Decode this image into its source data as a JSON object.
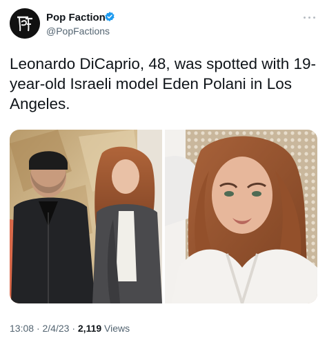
{
  "author": {
    "name": "Pop Faction",
    "handle": "@PopFactions",
    "avatar_icon": "pf-monogram-logo",
    "verified_color": "#1d9bf0"
  },
  "tweet": {
    "text": "Leonardo DiCaprio, 48, was spotted with 19-year-old Israeli model Eden Polani in Los Angeles."
  },
  "media": {
    "count": 2
  },
  "meta": {
    "time": "13:08",
    "separator": "·",
    "date": "2/4/23",
    "views_count": "2,119",
    "views_label": "Views"
  },
  "icons": {
    "more": "more-horizontal-icon",
    "verified": "verified-badge-icon"
  }
}
